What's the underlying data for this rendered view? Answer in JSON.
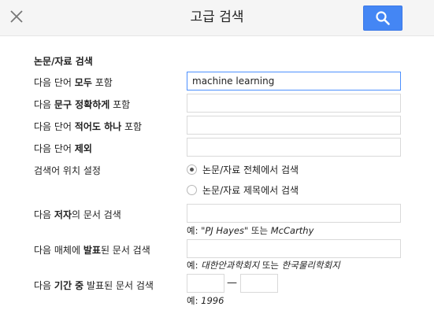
{
  "header": {
    "title": "고급 검색",
    "close_icon": "close-icon",
    "search_icon": "search-icon",
    "accent_color": "#4486f4"
  },
  "articles": {
    "section_title": "논문/자료 검색",
    "all_words": {
      "pre": "다음 단어 ",
      "bold": "모두",
      "post": " 포함",
      "value": "machine learning"
    },
    "exact_phrase": {
      "pre": "다음 ",
      "bold": "문구 정확하게",
      "post": " 포함",
      "value": ""
    },
    "any_words": {
      "pre": "다음 단어 ",
      "bold": "적어도 하나",
      "post": " 포함",
      "value": ""
    },
    "without_words": {
      "pre": "다음 단어 ",
      "bold": "제외",
      "value": ""
    },
    "occurrence": {
      "label": "검색어 위치 설정",
      "options": [
        "논문/자료 전체에서 검색",
        "논문/자료 제목에서 검색"
      ],
      "selected": 0
    },
    "author": {
      "pre": "다음 ",
      "bold": "저자",
      "post": "의 문서 검색",
      "value": "",
      "example_prefix": "예: ",
      "example_a": "\"PJ Hayes\"",
      "example_mid": " 또는 ",
      "example_b": "McCarthy"
    },
    "publication": {
      "pre": "다음 매체에 ",
      "bold": "발표",
      "post": "된 문서 검색",
      "value": "",
      "example_prefix": "예: ",
      "example_a": "대한안과학회지",
      "example_mid": " 또는 ",
      "example_b": "한국물리학회지"
    },
    "date_range": {
      "pre": "다음 ",
      "bold": "기간 중",
      "post": " 발표된 문서 검색",
      "from": "",
      "to": "",
      "dash": "—",
      "example_prefix": "예: ",
      "example_a": "1996"
    }
  }
}
